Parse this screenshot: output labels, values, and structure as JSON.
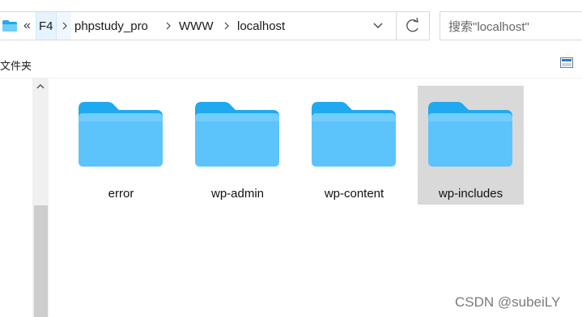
{
  "address": {
    "overflow": "«",
    "crumbs": [
      "F4",
      "phpstudy_pro",
      "WWW",
      "localhost"
    ]
  },
  "search": {
    "placeholder": "搜索\"localhost\""
  },
  "toolbar": {
    "label": "文件夹"
  },
  "items": [
    {
      "label": "error"
    },
    {
      "label": "wp-admin"
    },
    {
      "label": "wp-content"
    },
    {
      "label": "wp-includes"
    }
  ],
  "watermark": "CSDN @subeiLY",
  "colors": {
    "folder_tab": "#1ea9f0",
    "folder_body": "#58c3fa",
    "selection": "#d9d9d9",
    "breadcrumb_highlight": "#e5f3ff"
  },
  "icons": [
    "folder-icon",
    "chevron-right-icon",
    "chevron-down-icon",
    "refresh-icon",
    "view-icon",
    "scroll-up-icon"
  ]
}
